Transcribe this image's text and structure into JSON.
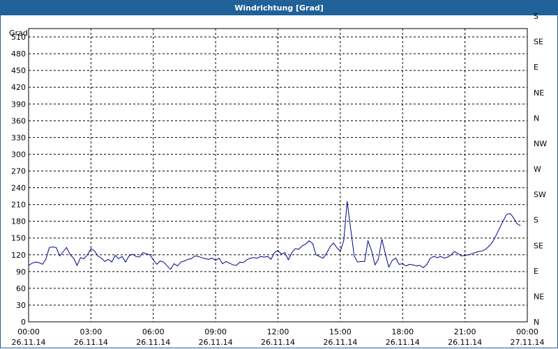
{
  "window": {
    "title": "Windrichtung [Grad]"
  },
  "chart_data": {
    "type": "line",
    "title": "Windrichtung [Grad]",
    "ylabel": "Grad",
    "ylim": [
      0,
      525
    ],
    "yticks": [
      0,
      30,
      60,
      90,
      120,
      150,
      180,
      210,
      240,
      270,
      300,
      330,
      360,
      390,
      420,
      450,
      480,
      510
    ],
    "y2ticks": [
      {
        "value": 0,
        "label": "N"
      },
      {
        "value": 45,
        "label": "NE"
      },
      {
        "value": 90,
        "label": "E"
      },
      {
        "value": 135,
        "label": "SE"
      },
      {
        "value": 180,
        "label": "S"
      },
      {
        "value": 225,
        "label": "SW"
      },
      {
        "value": 270,
        "label": "W"
      },
      {
        "value": 315,
        "label": "NW"
      },
      {
        "value": 360,
        "label": "N"
      },
      {
        "value": 405,
        "label": "NE"
      },
      {
        "value": 450,
        "label": "E"
      },
      {
        "value": 495,
        "label": "SE"
      },
      {
        "value": 540,
        "label": "S"
      }
    ],
    "xlim_hours": [
      0,
      24
    ],
    "xticks": [
      {
        "time": "00:00",
        "date": "26.11.14"
      },
      {
        "time": "03:00",
        "date": "26.11.14"
      },
      {
        "time": "06:00",
        "date": "26.11.14"
      },
      {
        "time": "09:00",
        "date": "26.11.14"
      },
      {
        "time": "12:00",
        "date": "26.11.14"
      },
      {
        "time": "15:00",
        "date": "26.11.14"
      },
      {
        "time": "18:00",
        "date": "26.11.14"
      },
      {
        "time": "21:00",
        "date": "26.11.14"
      },
      {
        "time": "00:00",
        "date": "27.11.14"
      }
    ],
    "grid": true,
    "line_color": "#00008b",
    "series": [
      {
        "x_hours": [
          0,
          0.17,
          0.33,
          0.5,
          0.67,
          0.83,
          1.0,
          1.17,
          1.33,
          1.5,
          1.67,
          1.83,
          2.0,
          2.17,
          2.33,
          2.5,
          2.67,
          2.83,
          3.0,
          3.17,
          3.33,
          3.5,
          3.67,
          3.83,
          4.0,
          4.17,
          4.33,
          4.5,
          4.67,
          4.83,
          5.0,
          5.17,
          5.33,
          5.5,
          5.67,
          5.83,
          6.0,
          6.17,
          6.33,
          6.5,
          6.67,
          6.83,
          7.0,
          7.17,
          7.33,
          7.5,
          7.67,
          7.83,
          8.0,
          8.17,
          8.33,
          8.5,
          8.67,
          8.83,
          9.0,
          9.17,
          9.33,
          9.5,
          9.67,
          9.83,
          10.0,
          10.17,
          10.33,
          10.5,
          10.67,
          10.83,
          11.0,
          11.17,
          11.33,
          11.5,
          11.67,
          11.83,
          12.0,
          12.17,
          12.33,
          12.5,
          12.67,
          12.83,
          13.0,
          13.17,
          13.33,
          13.5,
          13.67,
          13.83,
          14.0,
          14.17,
          14.33,
          14.5,
          14.67,
          14.83,
          15.0,
          15.17,
          15.33,
          15.5,
          15.67,
          15.83,
          16.0,
          16.17,
          16.33,
          16.5,
          16.67,
          16.83,
          17.0,
          17.17,
          17.33,
          17.5,
          17.67,
          17.83,
          18.0,
          18.17,
          18.33,
          18.5,
          18.67,
          18.83,
          19.0,
          19.17,
          19.33,
          19.5,
          19.67,
          19.83,
          20.0,
          20.17,
          20.33,
          20.5,
          20.67,
          20.83,
          21.0,
          21.17,
          21.33,
          21.5,
          21.67,
          21.83,
          22.0,
          22.17,
          22.33,
          22.5,
          22.67,
          22.83,
          23.0,
          23.17,
          23.33,
          23.5,
          23.67,
          23.83,
          24.0
        ],
        "values": [
          101,
          105,
          107,
          106,
          103,
          112,
          133,
          134,
          133,
          118,
          126,
          133,
          120,
          114,
          101,
          115,
          113,
          120,
          131,
          127,
          118,
          114,
          108,
          112,
          107,
          119,
          113,
          117,
          107,
          118,
          121,
          117,
          116,
          124,
          122,
          120,
          111,
          103,
          109,
          107,
          100,
          94,
          104,
          100,
          107,
          109,
          112,
          113,
          118,
          117,
          115,
          113,
          112,
          114,
          110,
          114,
          104,
          108,
          105,
          102,
          101,
          107,
          106,
          111,
          114,
          115,
          114,
          117,
          116,
          117,
          112,
          124,
          128,
          121,
          124,
          111,
          124,
          131,
          130,
          136,
          139,
          145,
          140,
          120,
          117,
          114,
          122,
          134,
          141,
          133,
          126,
          146,
          216,
          166,
          118,
          107,
          108,
          108,
          145,
          128,
          102,
          112,
          148,
          122,
          98,
          110,
          114,
          103,
          104,
          100,
          103,
          102,
          100,
          101,
          97,
          103,
          114,
          117,
          115,
          117,
          114,
          116,
          120,
          126,
          122,
          118,
          119,
          120,
          122,
          124,
          126,
          127,
          130,
          136,
          143,
          155,
          168,
          180,
          192,
          194,
          187,
          176,
          172
        ]
      }
    ]
  }
}
